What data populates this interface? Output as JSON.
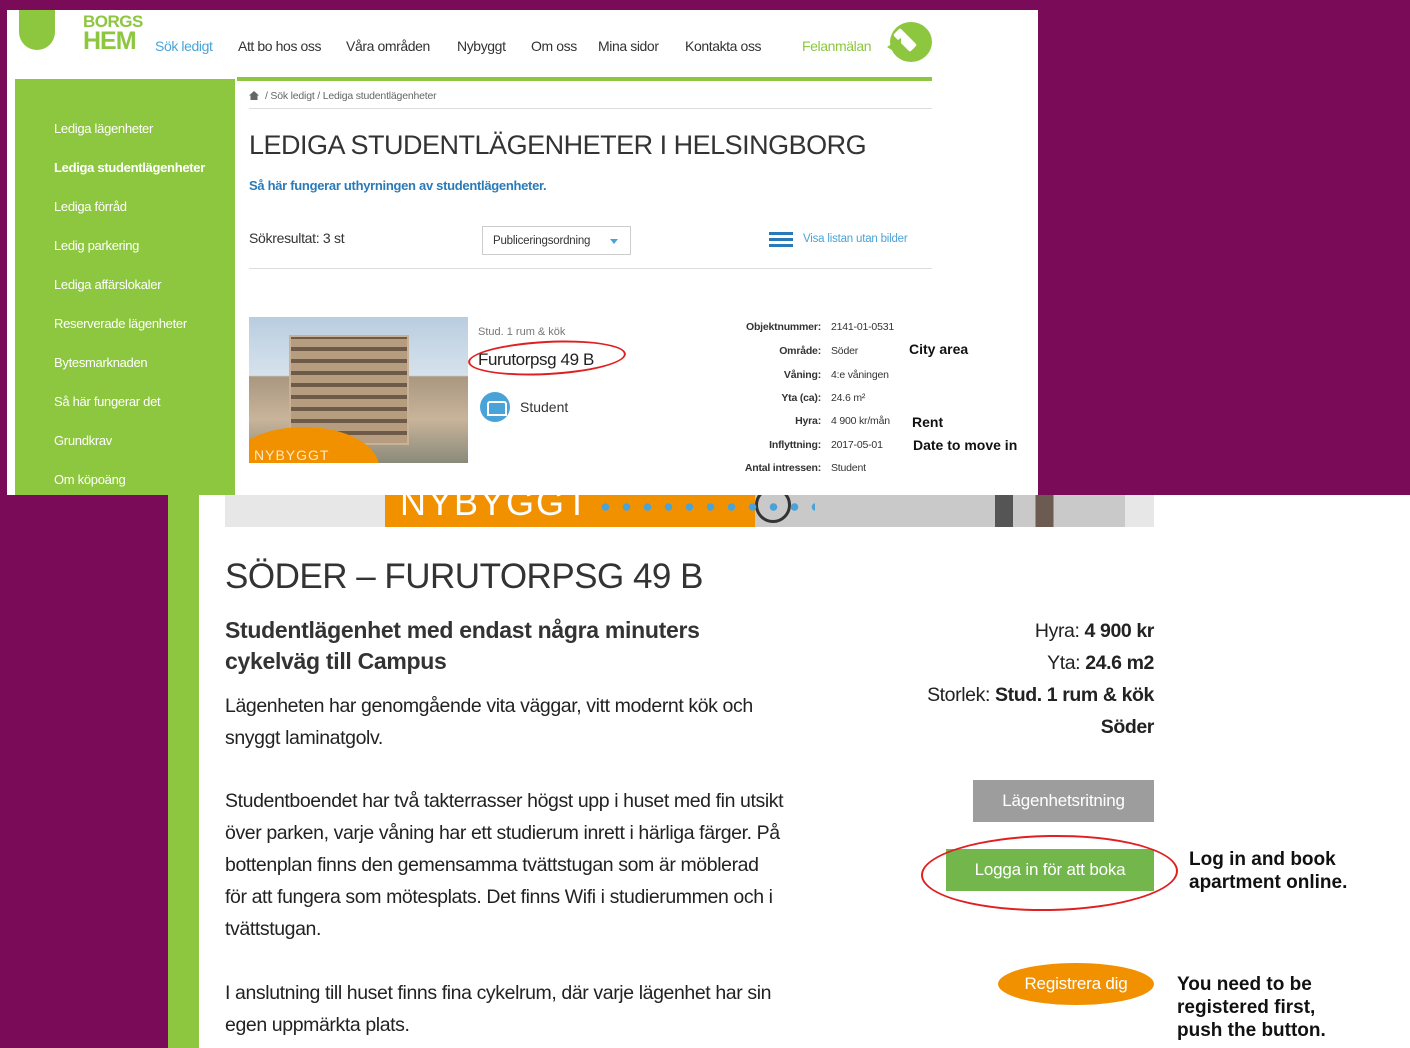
{
  "top": {
    "logo": {
      "line1": "BORGS",
      "line2": "HEM"
    },
    "nav": [
      "Sök ledigt",
      "Att bo hos oss",
      "Våra områden",
      "Nybyggt",
      "Om oss",
      "Mina sidor",
      "Kontakta oss"
    ],
    "felanmalan": "Felanmälan",
    "sidebar": [
      "Lediga lägenheter",
      "Lediga studentlägenheter",
      "Lediga förråd",
      "Ledig parkering",
      "Lediga affärslokaler",
      "Reserverade lägenheter",
      "Bytesmarknaden",
      "Så här fungerar det",
      "Grundkrav",
      "Om köpoäng"
    ],
    "breadcrumb": "/ Sök ledigt / Lediga studentlägenheter",
    "title": "LEDIGA STUDENTLÄGENHETER I HELSINGBORG",
    "how_link": "Så här fungerar uthyrningen av studentlägenheter.",
    "results": "Sökresultat: 3 st",
    "sort_value": "Publiceringsordning",
    "list_link": "Visa listan utan bilder",
    "listing": {
      "image_label": "NYBYGGT",
      "type": "Stud. 1 rum & kök",
      "address": "Furutorpsg 49 B",
      "category": "Student",
      "fields": [
        {
          "k": "Objektnummer:",
          "v": "2141-01-0531"
        },
        {
          "k": "Område:",
          "v": "Söder"
        },
        {
          "k": "Våning:",
          "v": "4:e våningen"
        },
        {
          "k": "Yta (ca):",
          "v": "24.6 m²"
        },
        {
          "k": "Hyra:",
          "v": "4 900 kr/mån"
        },
        {
          "k": "Inflyttning:",
          "v": "2017-05-01"
        },
        {
          "k": "Antal intressen:",
          "v": "Student"
        }
      ]
    },
    "annotations": {
      "city": "City area",
      "rent": "Rent",
      "move": "Date to move in"
    }
  },
  "bottom": {
    "banner_text": "NYBYGGT",
    "title": "SÖDER – FURUTORPSG 49 B",
    "subtitle": "Studentlägenhet med endast några minuters cykelväg till Campus",
    "p1": "Lägenheten har genomgående vita väggar, vitt modernt kök och snyggt laminatgolv.",
    "p2": "Studentboendet har två takterrasser högst upp i huset med fin utsikt över parken, varje våning har ett studierum inrett i härliga färger. På bottenplan finns den gemensamma tvättstugan som är möblerad för att fungera som mötesplats. Det finns Wifi i studierummen och i tvättstugan.",
    "p3": "I anslutning till huset finns fina cykelrum, där varje lägenhet har sin egen uppmärkta plats.",
    "facts": {
      "rent_label": "Hyra:",
      "rent": "4 900 kr",
      "size_label": "Yta:",
      "size": "24.6 m2",
      "type_label": "Storlek:",
      "type": "Stud. 1 rum & kök",
      "area": "Söder"
    },
    "btn_plan": "Lägenhetsritning",
    "btn_login": "Logga in för att boka",
    "btn_register": "Registrera dig",
    "note_login": "Log in and book apartment online.",
    "note_register": "You need to be registered first, push the button."
  },
  "colors": {
    "background": "#7a0b59",
    "green": "#8dc63f",
    "blue": "#4aa3d8",
    "orange": "#f29100",
    "annotation_red": "#e02020"
  }
}
